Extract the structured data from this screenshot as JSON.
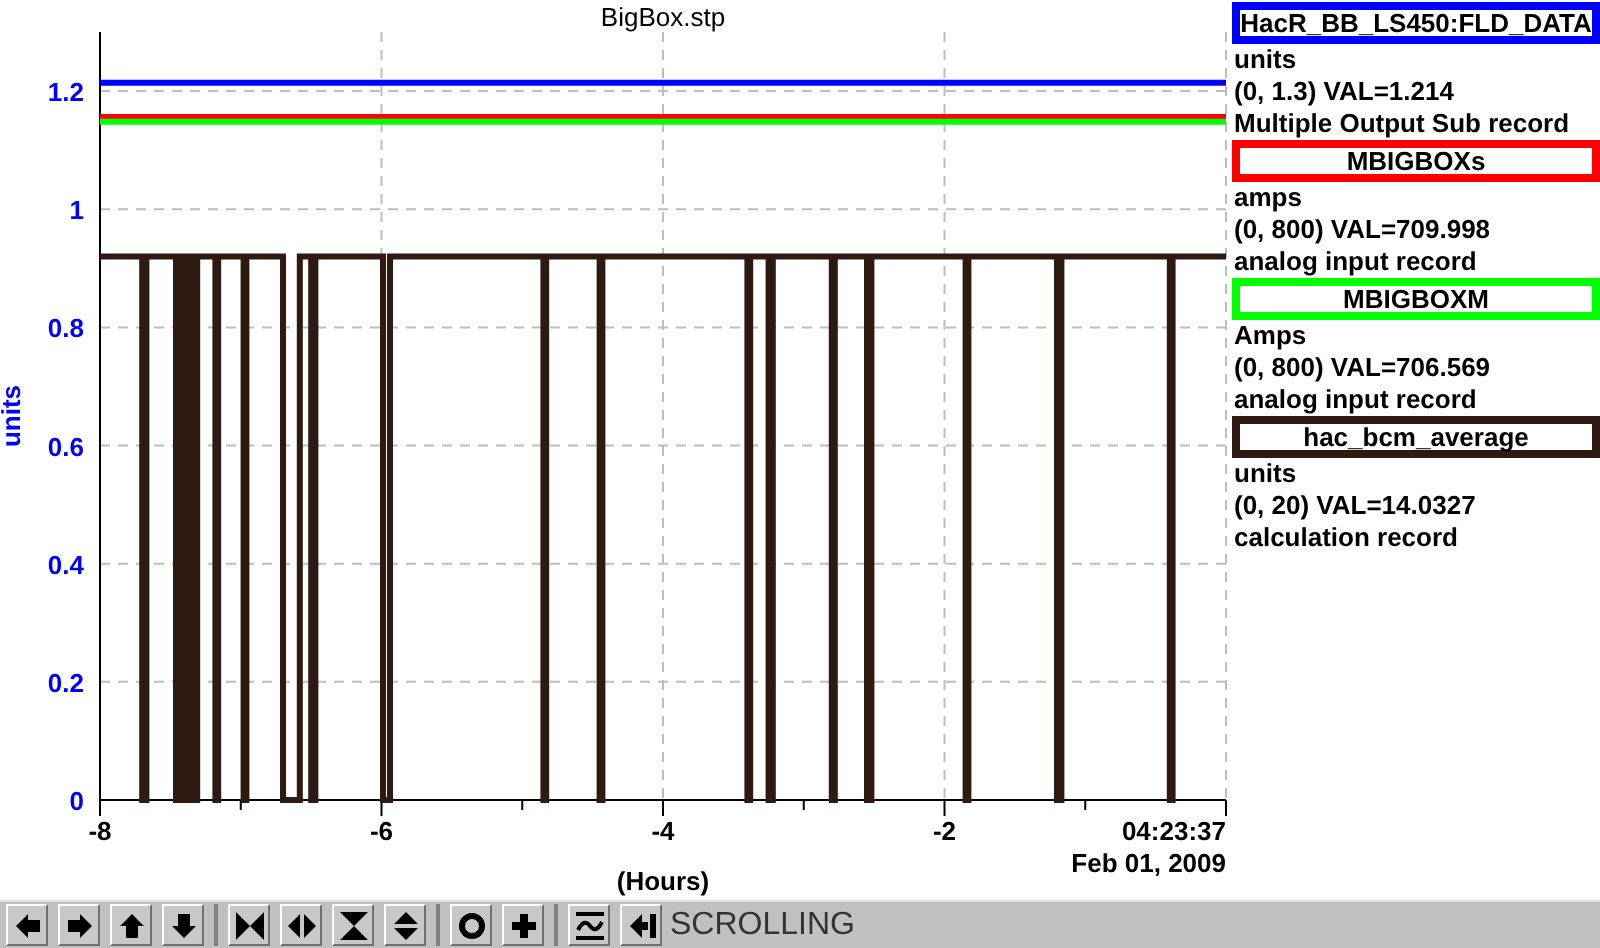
{
  "plot": {
    "chart_data": {
      "type": "line",
      "title": "BigBox.stp",
      "xlabel": "(Hours)",
      "ylabel": "units",
      "xlim": [
        -8,
        0
      ],
      "ylim": [
        0,
        1.3
      ],
      "xticks": [
        -8,
        -6,
        -4,
        -2
      ],
      "grid": true,
      "yticks": [
        0,
        0.2,
        0.4,
        0.6,
        0.8,
        1,
        1.2
      ],
      "x": [
        -8,
        -7.7,
        -7.7,
        -7.67,
        -7.67,
        -7.46,
        -7.46,
        -7.44,
        -7.44,
        -7.4,
        -7.4,
        -7.37,
        -7.37,
        -7.33,
        -7.33,
        -7.31,
        -7.31,
        -7.18,
        -7.18,
        -7.16,
        -7.16,
        -6.98,
        -6.98,
        -6.96,
        -6.96,
        -6.7,
        -6.7,
        -6.58,
        -6.58,
        -6.5,
        -6.5,
        -6.47,
        -6.47,
        -5.99,
        -5.99,
        -5.94,
        -5.94,
        -4.85,
        -4.85,
        -4.83,
        -4.83,
        -4.45,
        -4.45,
        -4.43,
        -4.43,
        -3.4,
        -3.4,
        -3.38,
        -3.38,
        -3.25,
        -3.25,
        -3.22,
        -3.22,
        -2.8,
        -2.8,
        -2.78,
        -2.78,
        -2.55,
        -2.55,
        -2.52,
        -2.52,
        -1.85,
        -1.85,
        -1.83,
        -1.83,
        -1.2,
        -1.2,
        -1.17,
        -1.17,
        -0.4,
        -0.4,
        -0.38,
        -0.38,
        0
      ],
      "series": [
        {
          "name": "HacR_BB_LS450:FLD_DATA",
          "color": "#0000ff",
          "values": [
            1.214,
            1.214,
            1.214,
            1.214,
            1.214,
            1.214,
            1.214,
            1.214,
            1.214,
            1.214,
            1.214,
            1.214,
            1.214,
            1.214,
            1.214,
            1.214,
            1.214,
            1.214,
            1.214,
            1.214,
            1.214,
            1.214,
            1.214,
            1.214,
            1.214,
            1.214,
            1.214,
            1.214,
            1.214,
            1.214,
            1.214,
            1.214,
            1.214,
            1.214,
            1.214,
            1.214,
            1.214,
            1.214,
            1.214,
            1.214,
            1.214,
            1.214,
            1.214,
            1.214,
            1.214,
            1.214,
            1.214,
            1.214,
            1.214,
            1.214,
            1.214,
            1.214,
            1.214,
            1.214,
            1.214,
            1.214,
            1.214,
            1.214,
            1.214,
            1.214,
            1.214,
            1.214,
            1.214,
            1.214,
            1.214,
            1.214,
            1.214,
            1.214,
            1.214,
            1.214,
            1.214,
            1.214,
            1.214,
            1.214
          ]
        },
        {
          "name": "MBIGBOXs",
          "color": "#ff0000",
          "values": [
            1.156,
            1.156,
            1.156,
            1.156,
            1.156,
            1.156,
            1.156,
            1.156,
            1.156,
            1.156,
            1.156,
            1.156,
            1.156,
            1.156,
            1.156,
            1.156,
            1.156,
            1.156,
            1.156,
            1.156,
            1.156,
            1.156,
            1.156,
            1.156,
            1.156,
            1.156,
            1.156,
            1.156,
            1.156,
            1.156,
            1.156,
            1.156,
            1.156,
            1.156,
            1.156,
            1.156,
            1.156,
            1.156,
            1.156,
            1.156,
            1.156,
            1.156,
            1.156,
            1.156,
            1.156,
            1.156,
            1.156,
            1.156,
            1.156,
            1.156,
            1.156,
            1.156,
            1.156,
            1.156,
            1.156,
            1.156,
            1.156,
            1.156,
            1.156,
            1.156,
            1.156,
            1.156,
            1.156,
            1.156,
            1.156,
            1.156,
            1.156,
            1.156,
            1.156,
            1.156,
            1.156,
            1.156,
            1.156,
            1.156
          ]
        },
        {
          "name": "MBIGBOXM",
          "color": "#00ff00",
          "values": [
            1.148,
            1.148,
            1.148,
            1.148,
            1.148,
            1.148,
            1.148,
            1.148,
            1.148,
            1.148,
            1.148,
            1.148,
            1.148,
            1.148,
            1.148,
            1.148,
            1.148,
            1.148,
            1.148,
            1.148,
            1.148,
            1.148,
            1.148,
            1.148,
            1.148,
            1.148,
            1.148,
            1.148,
            1.148,
            1.148,
            1.148,
            1.148,
            1.148,
            1.148,
            1.148,
            1.148,
            1.148,
            1.148,
            1.148,
            1.148,
            1.148,
            1.148,
            1.148,
            1.148,
            1.148,
            1.148,
            1.148,
            1.148,
            1.148,
            1.148,
            1.148,
            1.148,
            1.148,
            1.148,
            1.148,
            1.148,
            1.148,
            1.148,
            1.148,
            1.148,
            1.148,
            1.148,
            1.148,
            1.148,
            1.148,
            1.148,
            1.148,
            1.148,
            1.148,
            1.148,
            1.148,
            1.148,
            1.148,
            1.148
          ]
        },
        {
          "name": "hac_bcm_average",
          "color": "#2e1a10",
          "values": [
            0.92,
            0.92,
            0,
            0,
            0.92,
            0.92,
            0,
            0,
            0.92,
            0.92,
            0,
            0,
            0.92,
            0.92,
            0,
            0,
            0.92,
            0.92,
            0,
            0,
            0.92,
            0.92,
            0,
            0,
            0.92,
            0.92,
            0,
            0,
            0.92,
            0.92,
            0,
            0,
            0.92,
            0.92,
            0,
            0,
            0.92,
            0.92,
            0,
            0,
            0.92,
            0.92,
            0,
            0,
            0.92,
            0.92,
            0,
            0,
            0.92,
            0.92,
            0,
            0,
            0.92,
            0.92,
            0,
            0,
            0.92,
            0.92,
            0,
            0,
            0.92,
            0.92,
            0,
            0,
            0.92,
            0.92,
            0,
            0,
            0.92,
            0.92,
            0,
            0,
            0.92,
            0.92
          ]
        }
      ]
    },
    "end_time": "04:23:37",
    "date": "Feb 01, 2009"
  },
  "legend": [
    {
      "units": "units",
      "range_value": "(0, 1.3) VAL=1.214",
      "record_type": "Multiple Output Sub record"
    },
    {
      "units": "amps",
      "range_value": "(0, 800) VAL=709.998",
      "record_type": "analog input record"
    },
    {
      "units": "Amps",
      "range_value": "(0, 800) VAL=706.569",
      "record_type": "analog input record"
    },
    {
      "units": "units",
      "range_value": "(0, 20) VAL=14.0327",
      "record_type": "calculation record"
    }
  ],
  "toolbar": {
    "groups": [
      [
        {
          "kind": "left"
        },
        {
          "kind": "right"
        },
        {
          "kind": "up"
        },
        {
          "kind": "down"
        }
      ],
      [
        {
          "kind": "shrink-h"
        },
        {
          "kind": "expand-h"
        },
        {
          "kind": "shrink-v"
        },
        {
          "kind": "expand-v"
        }
      ],
      [
        {
          "kind": "circle"
        },
        {
          "kind": "plus"
        }
      ],
      [
        {
          "kind": "wave"
        },
        {
          "kind": "rewind"
        }
      ]
    ],
    "status": "SCROLLING"
  }
}
